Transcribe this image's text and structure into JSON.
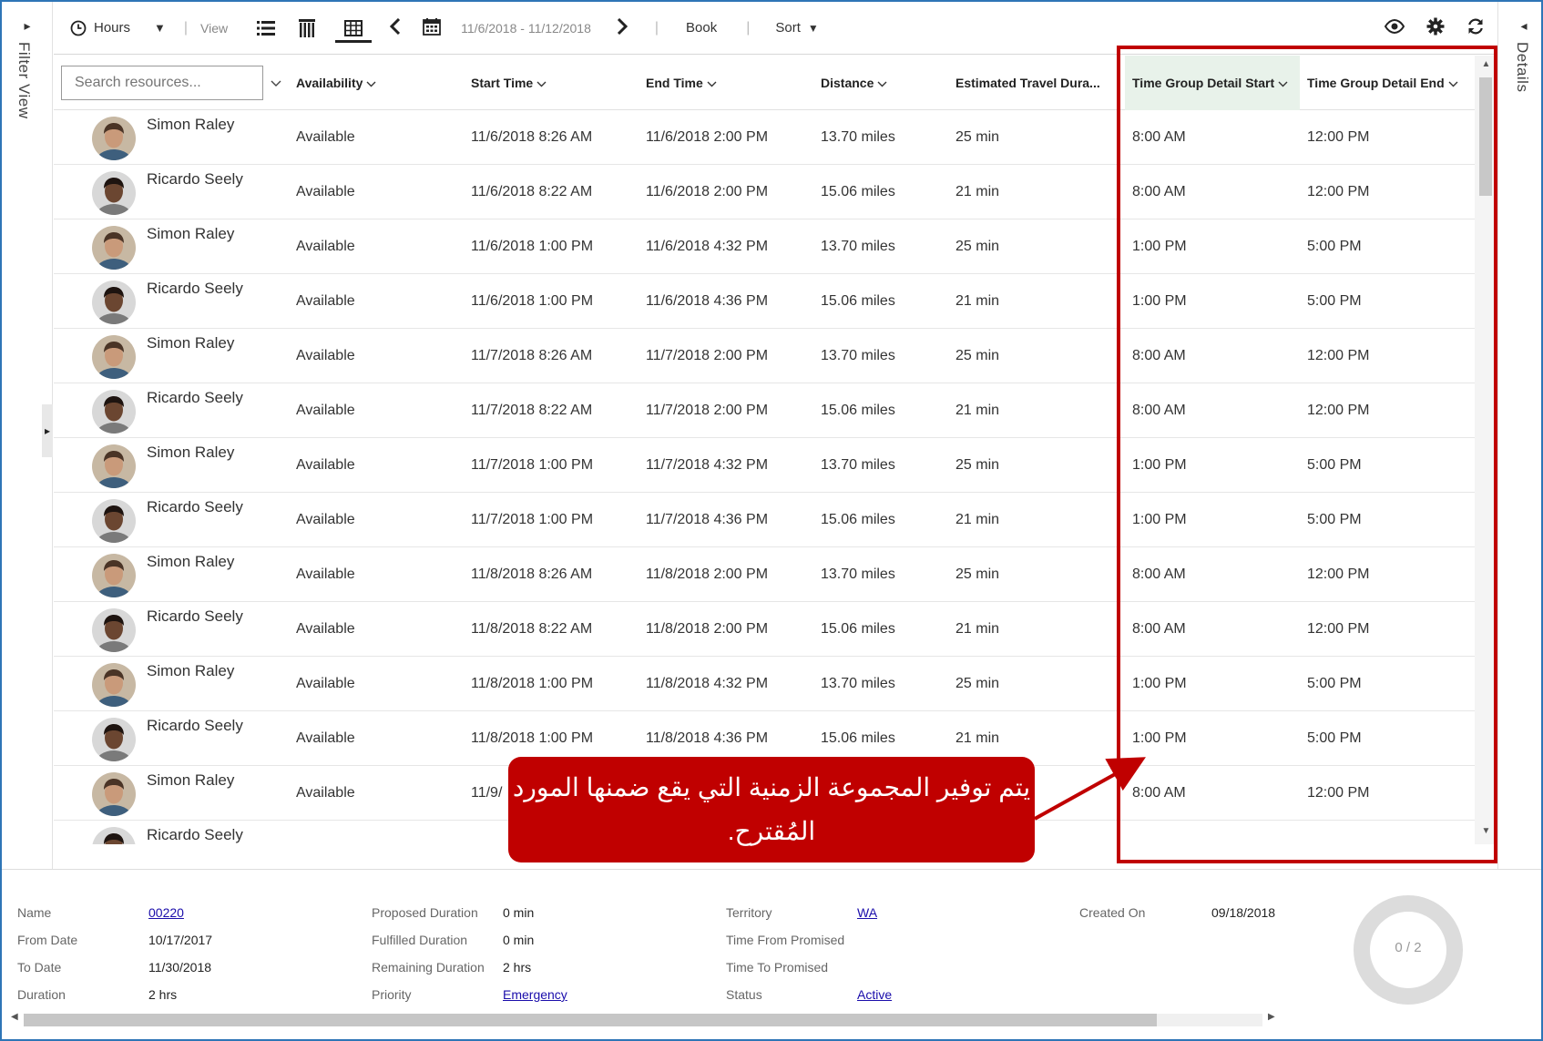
{
  "left_panel": {
    "label": "Filter View"
  },
  "right_panel": {
    "label": "Details"
  },
  "toolbar": {
    "hours_label": "Hours",
    "view_label": "View",
    "date_range": "11/6/2018 - 11/12/2018",
    "book_label": "Book",
    "sort_label": "Sort"
  },
  "search": {
    "placeholder": "Search resources..."
  },
  "columns": {
    "availability": "Availability",
    "start_time": "Start Time",
    "end_time": "End Time",
    "distance": "Distance",
    "travel": "Estimated Travel Dura...",
    "tg_start": "Time Group Detail Start",
    "tg_end": "Time Group Detail End"
  },
  "rows": [
    {
      "name": "Simon Raley",
      "availability": "Available",
      "start": "11/6/2018 8:26 AM",
      "end": "11/6/2018 2:00 PM",
      "distance": "13.70 miles",
      "travel": "25 min",
      "tg_start": "8:00 AM",
      "tg_end": "12:00 PM"
    },
    {
      "name": "Ricardo Seely",
      "availability": "Available",
      "start": "11/6/2018 8:22 AM",
      "end": "11/6/2018 2:00 PM",
      "distance": "15.06 miles",
      "travel": "21 min",
      "tg_start": "8:00 AM",
      "tg_end": "12:00 PM"
    },
    {
      "name": "Simon Raley",
      "availability": "Available",
      "start": "11/6/2018 1:00 PM",
      "end": "11/6/2018 4:32 PM",
      "distance": "13.70 miles",
      "travel": "25 min",
      "tg_start": "1:00 PM",
      "tg_end": "5:00 PM"
    },
    {
      "name": "Ricardo Seely",
      "availability": "Available",
      "start": "11/6/2018 1:00 PM",
      "end": "11/6/2018 4:36 PM",
      "distance": "15.06 miles",
      "travel": "21 min",
      "tg_start": "1:00 PM",
      "tg_end": "5:00 PM"
    },
    {
      "name": "Simon Raley",
      "availability": "Available",
      "start": "11/7/2018 8:26 AM",
      "end": "11/7/2018 2:00 PM",
      "distance": "13.70 miles",
      "travel": "25 min",
      "tg_start": "8:00 AM",
      "tg_end": "12:00 PM"
    },
    {
      "name": "Ricardo Seely",
      "availability": "Available",
      "start": "11/7/2018 8:22 AM",
      "end": "11/7/2018 2:00 PM",
      "distance": "15.06 miles",
      "travel": "21 min",
      "tg_start": "8:00 AM",
      "tg_end": "12:00 PM"
    },
    {
      "name": "Simon Raley",
      "availability": "Available",
      "start": "11/7/2018 1:00 PM",
      "end": "11/7/2018 4:32 PM",
      "distance": "13.70 miles",
      "travel": "25 min",
      "tg_start": "1:00 PM",
      "tg_end": "5:00 PM"
    },
    {
      "name": "Ricardo Seely",
      "availability": "Available",
      "start": "11/7/2018 1:00 PM",
      "end": "11/7/2018 4:36 PM",
      "distance": "15.06 miles",
      "travel": "21 min",
      "tg_start": "1:00 PM",
      "tg_end": "5:00 PM"
    },
    {
      "name": "Simon Raley",
      "availability": "Available",
      "start": "11/8/2018 8:26 AM",
      "end": "11/8/2018 2:00 PM",
      "distance": "13.70 miles",
      "travel": "25 min",
      "tg_start": "8:00 AM",
      "tg_end": "12:00 PM"
    },
    {
      "name": "Ricardo Seely",
      "availability": "Available",
      "start": "11/8/2018 8:22 AM",
      "end": "11/8/2018 2:00 PM",
      "distance": "15.06 miles",
      "travel": "21 min",
      "tg_start": "8:00 AM",
      "tg_end": "12:00 PM"
    },
    {
      "name": "Simon Raley",
      "availability": "Available",
      "start": "11/8/2018 1:00 PM",
      "end": "11/8/2018 4:32 PM",
      "distance": "13.70 miles",
      "travel": "25 min",
      "tg_start": "1:00 PM",
      "tg_end": "5:00 PM"
    },
    {
      "name": "Ricardo Seely",
      "availability": "Available",
      "start": "11/8/2018 1:00 PM",
      "end": "11/8/2018 4:36 PM",
      "distance": "15.06 miles",
      "travel": "21 min",
      "tg_start": "1:00 PM",
      "tg_end": "5:00 PM"
    },
    {
      "name": "Simon Raley",
      "availability": "Available",
      "start": "11/9/",
      "end": "",
      "distance": "",
      "travel": "",
      "tg_start": "8:00 AM",
      "tg_end": "12:00 PM"
    },
    {
      "name": "Ricardo Seely",
      "availability": "",
      "start": "",
      "end": "",
      "distance": "",
      "travel": "",
      "tg_start": "",
      "tg_end": ""
    }
  ],
  "callout": {
    "text": "يتم توفير المجموعة الزمنية التي يقع ضمنها المورد المُقترح."
  },
  "details": {
    "name_label": "Name",
    "name_value": "00220",
    "from_label": "From Date",
    "from_value": "10/17/2017",
    "to_label": "To Date",
    "to_value": "11/30/2018",
    "duration_label": "Duration",
    "duration_value": "2 hrs",
    "proposed_label": "Proposed Duration",
    "proposed_value": "0 min",
    "fulfilled_label": "Fulfilled Duration",
    "fulfilled_value": "0 min",
    "remaining_label": "Remaining Duration",
    "remaining_value": "2 hrs",
    "priority_label": "Priority",
    "priority_value": "Emergency",
    "territory_label": "Territory",
    "territory_value": "WA",
    "tfrom_label": "Time From Promised",
    "tto_label": "Time To Promised",
    "status_label": "Status",
    "status_value": "Active",
    "created_label": "Created On",
    "created_value": "09/18/2018",
    "progress_text": "0 / 2"
  },
  "colors": {
    "accent_red": "#c00000",
    "frame_blue": "#2e75b6",
    "header_highlight": "#e8f2ea"
  },
  "icons": [
    "clock-icon",
    "list-view-icon",
    "vertical-bars-icon",
    "grid-view-icon",
    "calendar-icon",
    "eye-icon",
    "gear-icon",
    "refresh-icon"
  ]
}
